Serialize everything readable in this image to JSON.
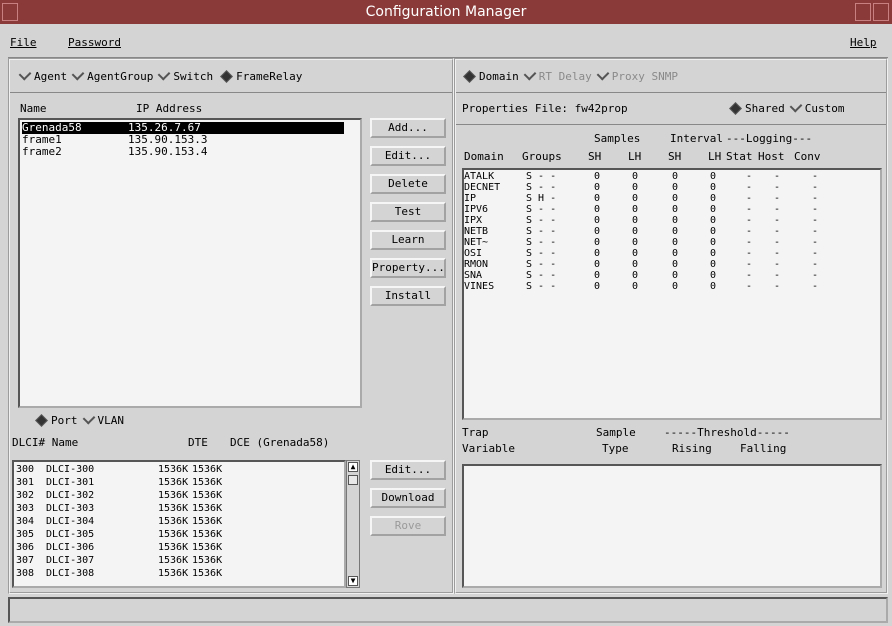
{
  "window": {
    "title": "Configuration Manager"
  },
  "menu": {
    "file": "File",
    "password": "Password",
    "help": "Help"
  },
  "left": {
    "radios": [
      {
        "label": "Agent",
        "state": "unchecked"
      },
      {
        "label": "AgentGroup",
        "state": "unchecked"
      },
      {
        "label": "Switch",
        "state": "unchecked"
      },
      {
        "label": "FrameRelay",
        "state": "checked"
      }
    ],
    "list_headers": {
      "name": "Name",
      "ip": "IP Address"
    },
    "agents": [
      {
        "name": "Grenada58",
        "ip": "135.26.7.67",
        "selected": true
      },
      {
        "name": "frame1",
        "ip": "135.90.153.3"
      },
      {
        "name": "frame2",
        "ip": "135.90.153.4"
      }
    ],
    "buttons": {
      "add": "Add...",
      "edit": "Edit...",
      "delete": "Delete",
      "test": "Test",
      "learn": "Learn",
      "property": "Property...",
      "install": "Install"
    },
    "port_radios": [
      {
        "label": "Port",
        "state": "checked"
      },
      {
        "label": "VLAN",
        "state": "unchecked"
      }
    ],
    "dlci_header": {
      "dlci": "DLCI# Name",
      "dte": "DTE",
      "dce": "DCE (Grenada58)"
    },
    "dlci_rows": [
      {
        "num": "300",
        "name": "DLCI-300",
        "dte": "1536K",
        "dce": "1536K"
      },
      {
        "num": "301",
        "name": "DLCI-301",
        "dte": "1536K",
        "dce": "1536K"
      },
      {
        "num": "302",
        "name": "DLCI-302",
        "dte": "1536K",
        "dce": "1536K"
      },
      {
        "num": "303",
        "name": "DLCI-303",
        "dte": "1536K",
        "dce": "1536K"
      },
      {
        "num": "304",
        "name": "DLCI-304",
        "dte": "1536K",
        "dce": "1536K"
      },
      {
        "num": "305",
        "name": "DLCI-305",
        "dte": "1536K",
        "dce": "1536K"
      },
      {
        "num": "306",
        "name": "DLCI-306",
        "dte": "1536K",
        "dce": "1536K"
      },
      {
        "num": "307",
        "name": "DLCI-307",
        "dte": "1536K",
        "dce": "1536K"
      },
      {
        "num": "308",
        "name": "DLCI-308",
        "dte": "1536K",
        "dce": "1536K"
      }
    ],
    "dlci_buttons": {
      "edit": "Edit...",
      "download": "Download",
      "rove": "Rove"
    }
  },
  "right": {
    "radios": [
      {
        "label": "Domain",
        "state": "checked"
      },
      {
        "label": "RT Delay",
        "state": "disabled"
      },
      {
        "label": "Proxy SNMP",
        "state": "disabled"
      }
    ],
    "properties_file": "Properties File: fw42prop",
    "shared": "Shared",
    "custom": "Custom",
    "table_headers": {
      "samples": "Samples",
      "interval": "Interval",
      "logging": "---Logging---",
      "domain": "Domain",
      "groups": "Groups",
      "sh1": "SH",
      "lh1": "LH",
      "sh2": "SH",
      "lh2": "LH",
      "stat": "Stat",
      "host": "Host",
      "conv": "Conv"
    },
    "domains": [
      {
        "name": "ATALK",
        "groups": "S - -"
      },
      {
        "name": "DECNET",
        "groups": "S - -"
      },
      {
        "name": "IP",
        "groups": "S H -"
      },
      {
        "name": "IPV6",
        "groups": "S - -"
      },
      {
        "name": "IPX",
        "groups": "S - -"
      },
      {
        "name": "NETB",
        "groups": "S - -"
      },
      {
        "name": "NET~",
        "groups": "S - -"
      },
      {
        "name": "OSI",
        "groups": "S - -"
      },
      {
        "name": "RMON",
        "groups": "S - -"
      },
      {
        "name": "SNA",
        "groups": "S - -"
      },
      {
        "name": "VINES",
        "groups": "S - -"
      }
    ],
    "cells": {
      "zero": "0",
      "dash": "-"
    },
    "trap_headers": {
      "trap": "Trap",
      "variable": "Variable",
      "sample": "Sample",
      "type": "Type",
      "threshold": "-----Threshold-----",
      "rising": "Rising",
      "falling": "Falling"
    }
  }
}
